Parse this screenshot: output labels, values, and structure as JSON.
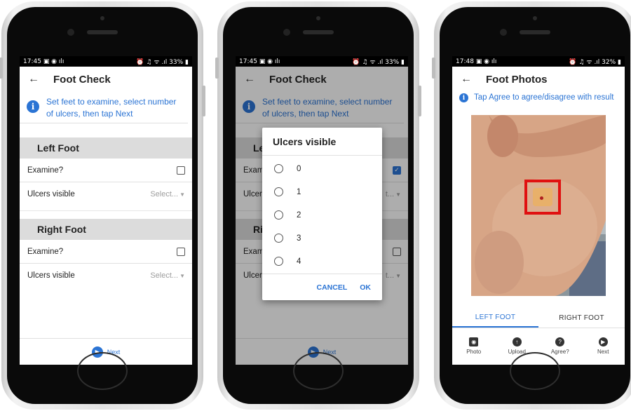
{
  "phone1": {
    "status": {
      "time": "17:45",
      "left_icons": "▣ ◉ ılı",
      "right": "⏰ ♫ ᯤ .ıl 33% ▮"
    },
    "title": "Foot Check",
    "info": "Set feet to examine, select number of ulcers, then tap Next",
    "left_foot": {
      "header": "Left Foot",
      "examine": "Examine?",
      "ulcers": "Ulcers visible",
      "select": "Select..."
    },
    "right_foot": {
      "header": "Right Foot",
      "examine": "Examine?",
      "ulcers": "Ulcers visible",
      "select": "Select..."
    },
    "next": "Next"
  },
  "phone2": {
    "status": {
      "time": "17:45",
      "left_icons": "▣ ◉ ılı",
      "right": "⏰ ♫ ᯤ .ıl 33% ▮"
    },
    "title": "Foot Check",
    "info": "Set feet to examine, select number of ulcers, then tap Next",
    "behind": {
      "le": "Le",
      "exam": "Exam",
      "ulcer": "Ulcer",
      "ri": "Ri",
      "exam2": "Exam",
      "ulcer2": "Ulcer",
      "sel1": "t...",
      "sel2": "t..."
    },
    "dialog": {
      "title": "Ulcers visible",
      "options": [
        "0",
        "1",
        "2",
        "3",
        "4"
      ],
      "cancel": "CANCEL",
      "ok": "OK"
    },
    "next": "Next"
  },
  "phone3": {
    "status": {
      "time": "17:48",
      "left_icons": "▣ ◉ ılı",
      "right": "⏰ ♫ ᯤ .ıl 32% ▮"
    },
    "title": "Foot Photos",
    "info": "Tap Agree to agree/disagree with result",
    "tabs": [
      "LEFT FOOT",
      "RIGHT FOOT"
    ],
    "actions": [
      "Photo",
      "Upload",
      "Agree?",
      "Next"
    ]
  },
  "colors": {
    "accent": "#2b74d4",
    "highlight_box": "#e01010"
  }
}
